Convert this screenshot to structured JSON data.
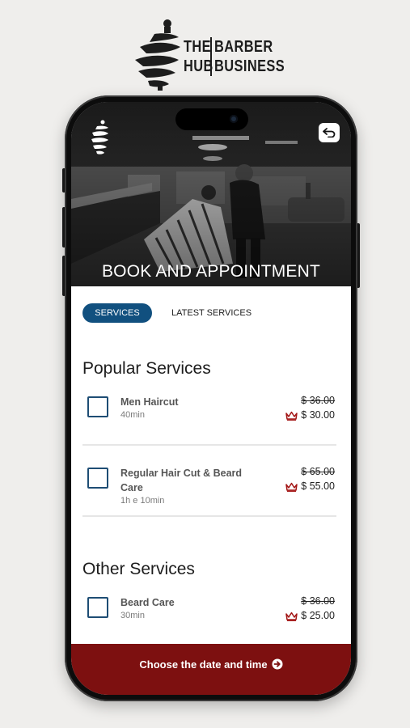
{
  "brand": {
    "word_the": "THE",
    "word_hub": "HUB",
    "word_barber": "BARBER",
    "word_business": "BUSINESS"
  },
  "hero": {
    "title": "BOOK AND APPOINTMENT",
    "back_icon": "return-arrow-icon"
  },
  "tabs": [
    {
      "label": "SERVICES",
      "active": true
    },
    {
      "label": "LATEST SERVICES",
      "active": false
    }
  ],
  "popular": {
    "title": "Popular Services",
    "items": [
      {
        "name": "Men Haircut",
        "duration": "40min",
        "old_price": "$ 36.00",
        "new_price": "$ 30.00"
      },
      {
        "name": "Regular Hair Cut & Beard Care",
        "duration": "1h e 10min",
        "old_price": "$ 65.00",
        "new_price": "$ 55.00"
      }
    ]
  },
  "other": {
    "title": "Other Services",
    "items": [
      {
        "name": "Beard Care",
        "duration": "30min",
        "old_price": "$ 36.00",
        "new_price": "$ 25.00"
      }
    ]
  },
  "cta": {
    "label": "Choose the date and time"
  },
  "colors": {
    "accent_blue": "#11507f",
    "cta_red": "#7d1010",
    "crown_red": "#a31515",
    "checkbox_border": "#1e4d74"
  }
}
